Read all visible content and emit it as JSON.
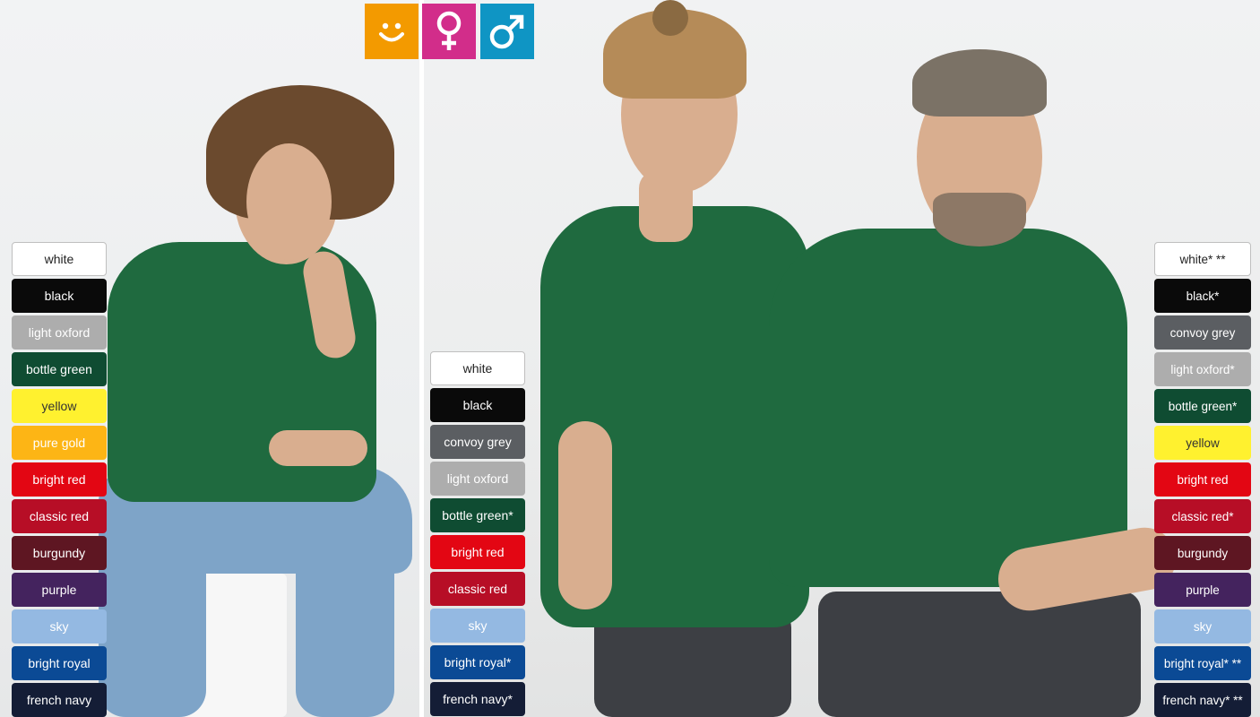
{
  "icons": [
    {
      "name": "kids-smiley-icon",
      "color": "#f39a00"
    },
    {
      "name": "female-symbol-icon",
      "color": "#d22d8a"
    },
    {
      "name": "male-symbol-icon",
      "color": "#0f95c4"
    }
  ],
  "swatches": {
    "kids": [
      {
        "label": "white",
        "bg": "#ffffff",
        "fg": "#222222",
        "border": "#bfbfbf"
      },
      {
        "label": "black",
        "bg": "#0a0a0a",
        "fg": "#ffffff"
      },
      {
        "label": "light oxford",
        "bg": "#adadad",
        "fg": "#ffffff"
      },
      {
        "label": "bottle green",
        "bg": "#0f4c32",
        "fg": "#ffffff"
      },
      {
        "label": "yellow",
        "bg": "#fff12f",
        "fg": "#333333"
      },
      {
        "label": "pure gold",
        "bg": "#fdb515",
        "fg": "#ffffff"
      },
      {
        "label": "bright red",
        "bg": "#e30613",
        "fg": "#ffffff"
      },
      {
        "label": "classic red",
        "bg": "#b70e26",
        "fg": "#ffffff"
      },
      {
        "label": "burgundy",
        "bg": "#5e1622",
        "fg": "#ffffff"
      },
      {
        "label": "purple",
        "bg": "#44235e",
        "fg": "#ffffff"
      },
      {
        "label": "sky",
        "bg": "#94b9e2",
        "fg": "#ffffff"
      },
      {
        "label": "bright royal",
        "bg": "#0b4a95",
        "fg": "#ffffff"
      },
      {
        "label": "french navy",
        "bg": "#141d36",
        "fg": "#ffffff"
      }
    ],
    "women": [
      {
        "label": "white",
        "bg": "#ffffff",
        "fg": "#222222",
        "border": "#bfbfbf"
      },
      {
        "label": "black",
        "bg": "#0a0a0a",
        "fg": "#ffffff"
      },
      {
        "label": "convoy grey",
        "bg": "#5b5e62",
        "fg": "#ffffff"
      },
      {
        "label": "light oxford",
        "bg": "#adadad",
        "fg": "#ffffff"
      },
      {
        "label": "bottle green*",
        "bg": "#0f4c32",
        "fg": "#ffffff"
      },
      {
        "label": "bright red",
        "bg": "#e30613",
        "fg": "#ffffff"
      },
      {
        "label": "classic red",
        "bg": "#b70e26",
        "fg": "#ffffff"
      },
      {
        "label": "sky",
        "bg": "#94b9e2",
        "fg": "#ffffff"
      },
      {
        "label": "bright royal*",
        "bg": "#0b4a95",
        "fg": "#ffffff"
      },
      {
        "label": "french navy*",
        "bg": "#141d36",
        "fg": "#ffffff"
      }
    ],
    "men": [
      {
        "label": "white* **",
        "bg": "#ffffff",
        "fg": "#222222",
        "border": "#bfbfbf"
      },
      {
        "label": "black*",
        "bg": "#0a0a0a",
        "fg": "#ffffff"
      },
      {
        "label": "convoy grey",
        "bg": "#5b5e62",
        "fg": "#ffffff"
      },
      {
        "label": "light oxford*",
        "bg": "#adadad",
        "fg": "#ffffff"
      },
      {
        "label": "bottle green*",
        "bg": "#0f4c32",
        "fg": "#ffffff"
      },
      {
        "label": "yellow",
        "bg": "#fff12f",
        "fg": "#333333"
      },
      {
        "label": "bright red",
        "bg": "#e30613",
        "fg": "#ffffff"
      },
      {
        "label": "classic red*",
        "bg": "#b70e26",
        "fg": "#ffffff"
      },
      {
        "label": "burgundy",
        "bg": "#5e1622",
        "fg": "#ffffff"
      },
      {
        "label": "purple",
        "bg": "#44235e",
        "fg": "#ffffff"
      },
      {
        "label": "sky",
        "bg": "#94b9e2",
        "fg": "#ffffff"
      },
      {
        "label": "bright royal* **",
        "bg": "#0b4a95",
        "fg": "#ffffff"
      },
      {
        "label": "french navy* **",
        "bg": "#141d36",
        "fg": "#ffffff"
      }
    ]
  }
}
